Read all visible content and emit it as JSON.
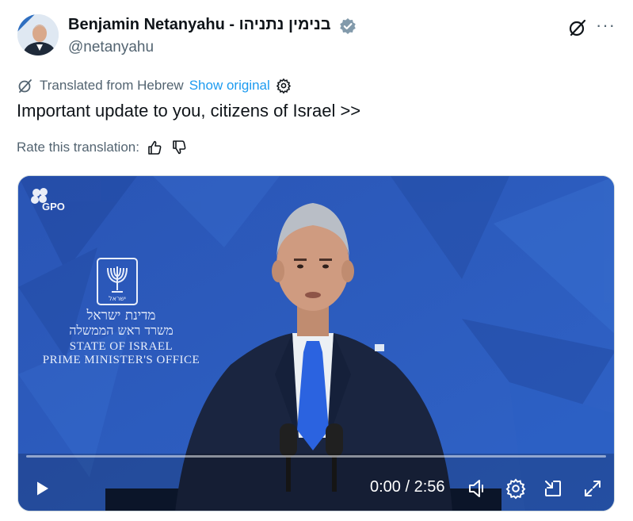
{
  "author": {
    "name": "Benjamin Netanyahu - בנימין נתניהו",
    "handle": "@netanyahu",
    "verified": true,
    "verified_color": "#829aab"
  },
  "header_actions": {
    "grok_icon": "grok-icon",
    "more_icon": "more-horizontal-icon",
    "more_label": "···"
  },
  "translation": {
    "label": "Translated from Hebrew",
    "show_original": "Show original",
    "rate_label": "Rate this translation:"
  },
  "tweet": {
    "text": "Important update to you, citizens of Israel >>"
  },
  "video": {
    "watermark": "GPO",
    "backdrop_hebrew_1": "מדינת ישראל",
    "backdrop_hebrew_2": "משרד ראש הממשלה",
    "backdrop_english_1": "STATE OF ISRAEL",
    "backdrop_english_2": "PRIME MINISTER'S OFFICE",
    "emblem_caption": "ישראל",
    "time_display": "0:00 / 2:56",
    "progress": 0,
    "progress_color": "#1d9bf0"
  },
  "colors": {
    "link": "#1d9bf0",
    "secondary_text": "#536471",
    "primary_text": "#0f1419",
    "video_bg": "#2d58b8"
  }
}
